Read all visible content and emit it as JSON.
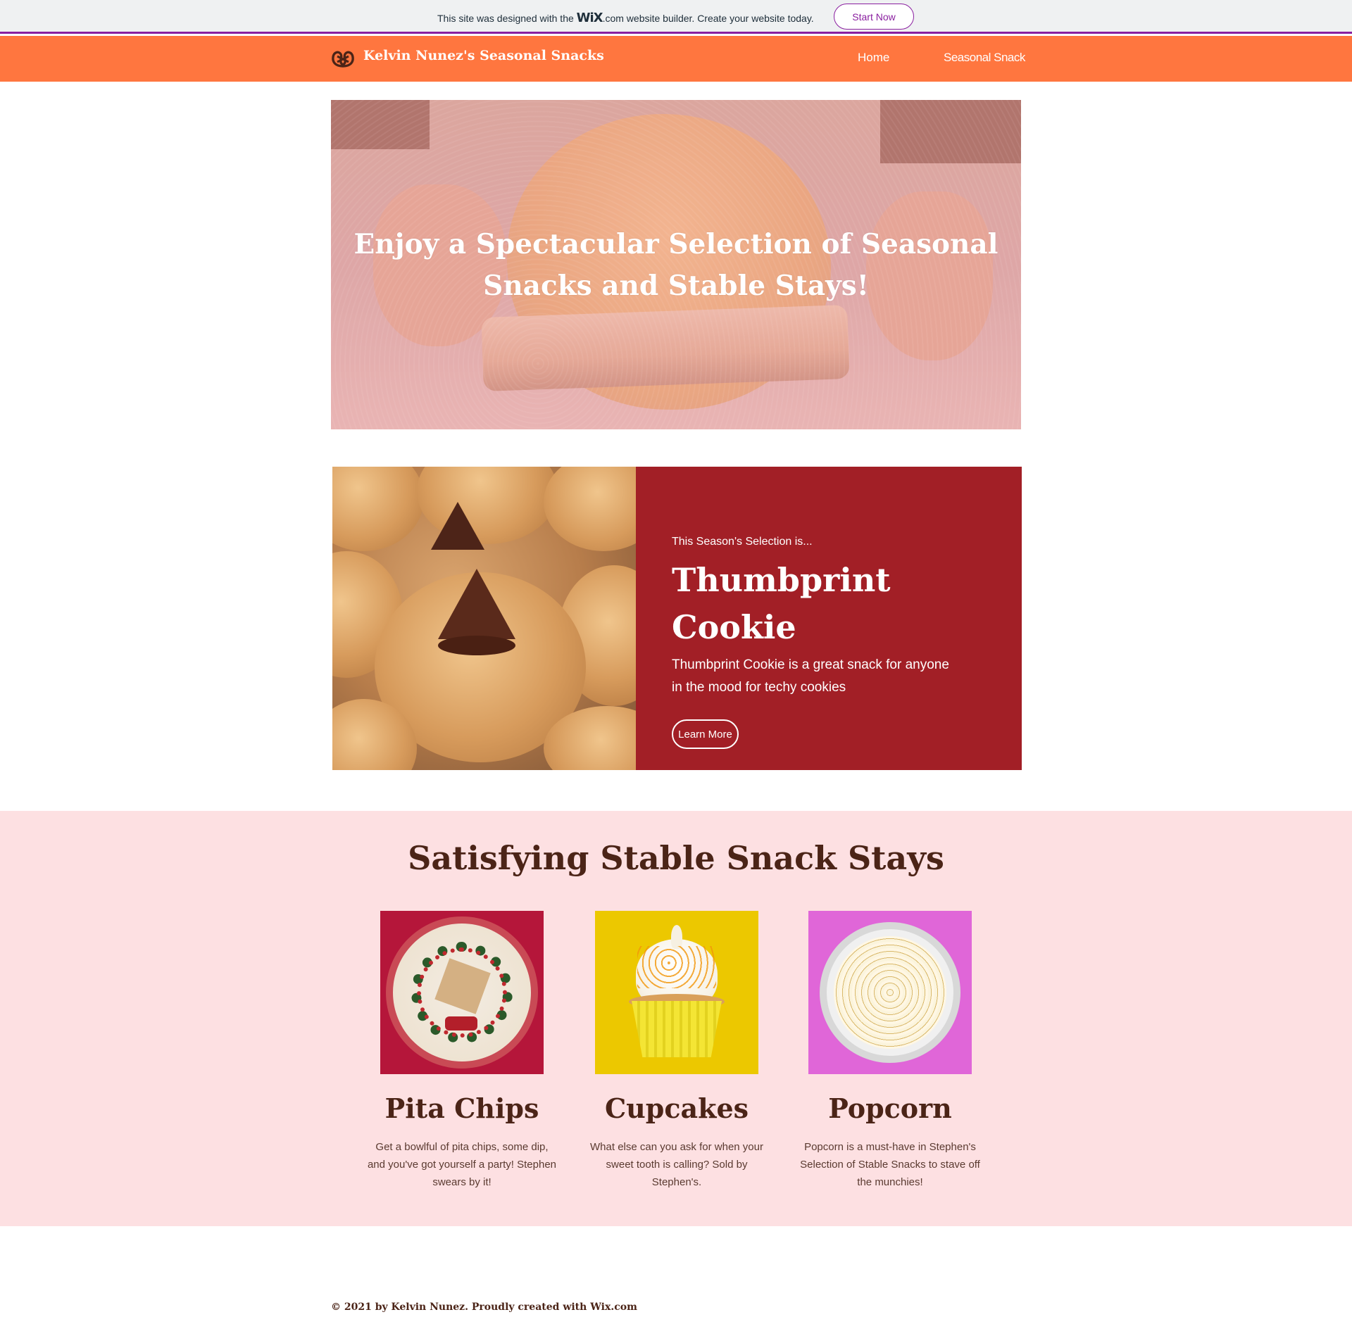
{
  "wix_banner": {
    "text_before": "This site was designed with the ",
    "brand": "WiX",
    "brand_suffix": ".com",
    "text_after": " website builder. Create your website today.",
    "cta": "Start Now"
  },
  "header": {
    "site_title": "Kelvin Nunez's Seasonal Snacks",
    "logo_icon": "pretzel-icon",
    "nav": [
      {
        "label": "Home"
      },
      {
        "label": "Seasonal Snack"
      }
    ]
  },
  "hero": {
    "title": "Enjoy a Spectacular Selection of Seasonal Snacks and Stable Stays!"
  },
  "feature": {
    "kicker": "This Season's Selection is...",
    "title": "Thumbprint Cookie",
    "description": "Thumbprint Cookie is a great snack for anyone in the mood for techy cookies",
    "button": "Learn More"
  },
  "stays": {
    "title": "Satisfying Stable Snack Stays",
    "cards": [
      {
        "name": "Pita Chips",
        "description": "Get a bowlful of pita chips, some dip, and you've got yourself a party! Stephen swears by it!"
      },
      {
        "name": "Cupcakes",
        "description": "What else can you ask for when your sweet tooth is calling? Sold by Stephen's."
      },
      {
        "name": "Popcorn",
        "description": "Popcorn is a must-have in Stephen's Selection of Stable Snacks to stave off the munchies!"
      }
    ]
  },
  "footer": {
    "text": "© 2021 by Kelvin Nunez. Proudly created with Wix.com"
  },
  "colors": {
    "header": "#ff763f",
    "feature_panel": "#a21f26",
    "stays_bg": "#fde0e2",
    "heading_brown": "#4b2417",
    "wix_purple": "#8a1fa0"
  }
}
